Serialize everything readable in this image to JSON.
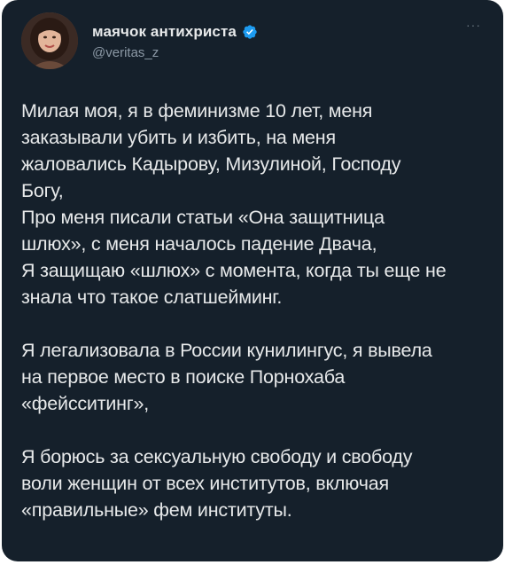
{
  "author": {
    "display_name": "маячок антихриста",
    "handle": "@veritas_z",
    "verified_color": "#1d9bf0",
    "avatar_icon": "avatar-photo"
  },
  "menu": {
    "more_label": "···"
  },
  "tweet": {
    "paragraphs": [
      "Милая моя, я в феминизме 10 лет, меня\nзаказывали убить и избить, на меня\nжаловались Кадырову, Мизулиной, Господу\nБогу,\nПро меня писали статьи «Она защитница\nшлюх», с меня началось падение Двача,\nЯ защищаю «шлюх» с момента, когда ты еще не\nзнала что такое слатшейминг.",
      "Я легализовала в России кунилингус, я вывела\nна первое место в поиске Порнохаба\n«фейсситинг»,",
      "Я борюсь за сексуальную свободу и свободу\nволи женщин от всех институтов, включая\n«правильные» фем институты."
    ]
  },
  "colors": {
    "background": "#15202b",
    "text": "#e7e9ea",
    "secondary_text": "#8b98a5"
  }
}
